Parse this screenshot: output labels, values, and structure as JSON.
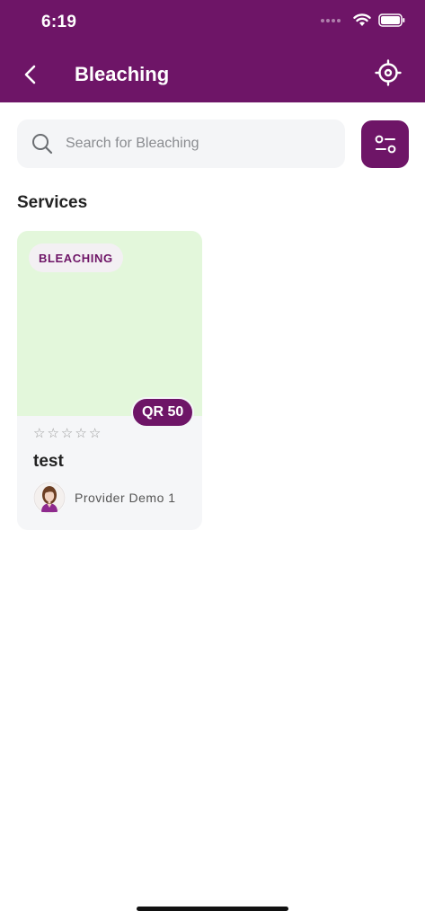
{
  "status_bar": {
    "time": "6:19"
  },
  "header": {
    "title": "Bleaching",
    "back_icon": "chevron-left-icon",
    "locate_icon": "crosshair-location-icon",
    "background_color": "#6E1567"
  },
  "search": {
    "placeholder": "Search for Bleaching",
    "value": "",
    "icon": "search-icon"
  },
  "filter_button": {
    "icon": "sliders-filter-icon"
  },
  "section": {
    "title": "Services"
  },
  "services": [
    {
      "category": "BLEACHING",
      "price": "QR 50",
      "rating": 0,
      "rating_max": 5,
      "title": "test",
      "provider_name": "Provider Demo 1",
      "image_color": "#E3F7DB"
    }
  ],
  "colors": {
    "accent": "#6E1567",
    "card_bg": "#F5F6F8"
  }
}
